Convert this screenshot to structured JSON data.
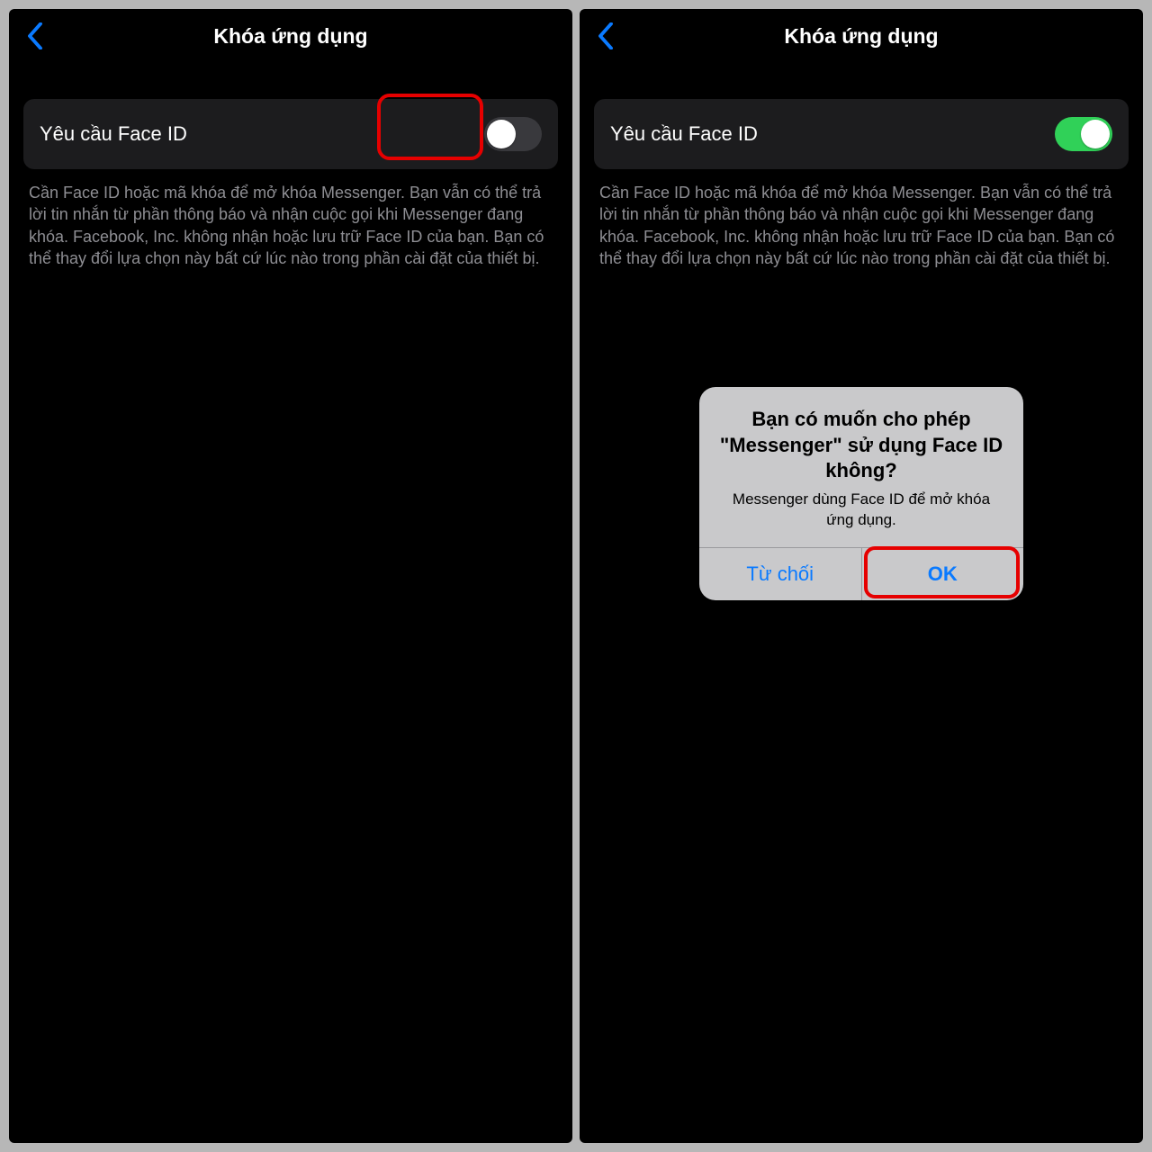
{
  "left": {
    "header": {
      "title": "Khóa ứng dụng"
    },
    "row": {
      "label": "Yêu cầu Face ID",
      "toggle_on": false
    },
    "description": "Cần Face ID hoặc mã khóa để mở khóa Messenger. Bạn vẫn có thể trả lời tin nhắn từ phần thông báo và nhận cuộc gọi khi Messenger đang khóa. Facebook, Inc. không nhận hoặc lưu trữ Face ID của bạn. Bạn có thể thay đổi lựa chọn này bất cứ lúc nào trong phần cài đặt của thiết bị."
  },
  "right": {
    "header": {
      "title": "Khóa ứng dụng"
    },
    "row": {
      "label": "Yêu cầu Face ID",
      "toggle_on": true
    },
    "description": "Cần Face ID hoặc mã khóa để mở khóa Messenger. Bạn vẫn có thể trả lời tin nhắn từ phần thông báo và nhận cuộc gọi khi Messenger đang khóa. Facebook, Inc. không nhận hoặc lưu trữ Face ID của bạn. Bạn có thể thay đổi lựa chọn này bất cứ lúc nào trong phần cài đặt của thiết bị.",
    "alert": {
      "title": "Bạn có muốn cho phép \"Messenger\" sử dụng Face ID không?",
      "message": "Messenger dùng Face ID để mở khóa ứng dụng.",
      "deny": "Từ chối",
      "ok": "OK"
    }
  }
}
